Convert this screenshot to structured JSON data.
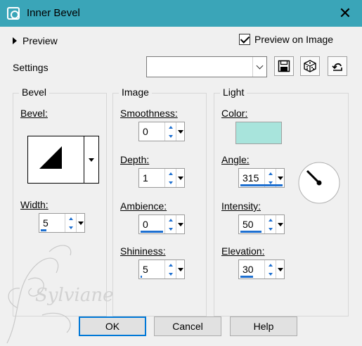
{
  "window": {
    "title": "Inner Bevel"
  },
  "preview": {
    "label": "Preview",
    "on_image_label": "Preview on Image",
    "on_image_checked": true
  },
  "settings": {
    "label": "Settings",
    "value": ""
  },
  "bevel": {
    "group_title": "Bevel",
    "bevel_label": "Bevel:",
    "width_label": "Width:",
    "width_value": "5"
  },
  "image": {
    "group_title": "Image",
    "smoothness_label": "Smoothness:",
    "smoothness_value": "0",
    "depth_label": "Depth:",
    "depth_value": "1",
    "ambience_label": "Ambience:",
    "ambience_value": "0",
    "shininess_label": "Shininess:",
    "shininess_value": "5"
  },
  "light": {
    "group_title": "Light",
    "color_label": "Color:",
    "color_value": "#a8e4dc",
    "angle_label": "Angle:",
    "angle_value": "315",
    "intensity_label": "Intensity:",
    "intensity_value": "50",
    "elevation_label": "Elevation:",
    "elevation_value": "30"
  },
  "buttons": {
    "ok": "OK",
    "cancel": "Cancel",
    "help": "Help"
  },
  "watermark": {
    "text": "Sylviane"
  },
  "colors": {
    "titlebar": "#3aa5b8",
    "accent": "#1d6fd0",
    "default_button_border": "#0078d7"
  }
}
